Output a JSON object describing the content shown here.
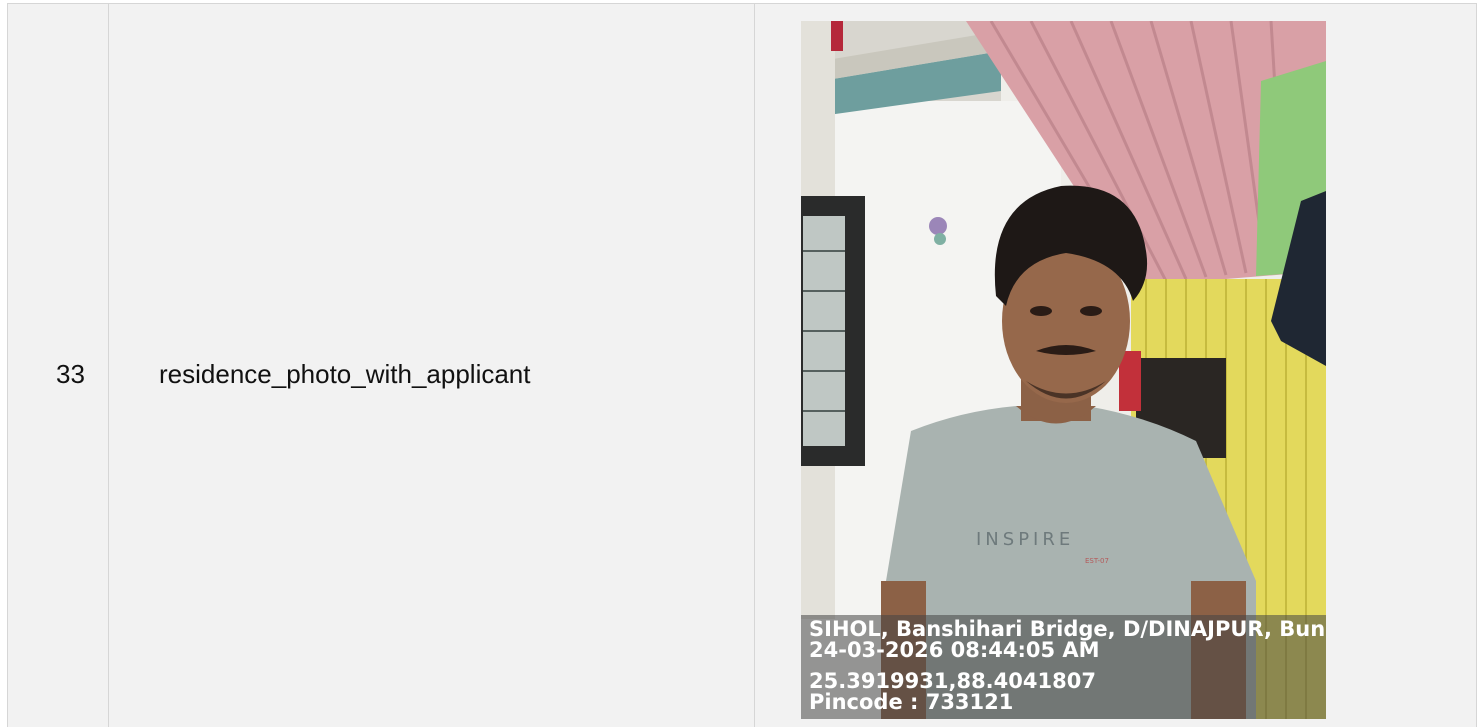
{
  "row": {
    "number": "33",
    "field_name": "residence_photo_with_applicant"
  },
  "photo": {
    "shirt_text": "INSPIRE",
    "shirt_subtext": "EST-07",
    "stamp": {
      "location": "SIHOL, Banshihari Bridge, D/DINAJPUR, Bun",
      "datetime": "24-03-2026 08:44:05 AM",
      "coordinates": "25.3919931,88.4041807",
      "pincode": "Pincode : 733121"
    }
  },
  "colors": {
    "row_background": "#f2f2f2",
    "border": "#d6d6d6",
    "roof": "#d9a0a6",
    "wall_yellow": "#e3d95c",
    "shirt": "#a9b3b0"
  }
}
